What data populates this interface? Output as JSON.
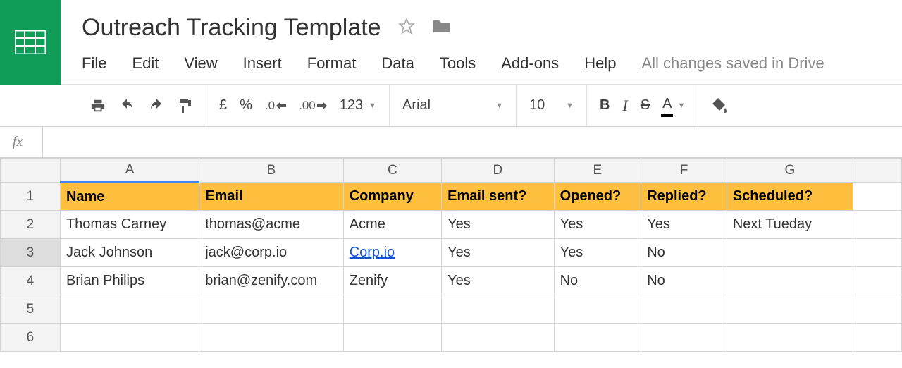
{
  "doc": {
    "title": "Outreach Tracking Template",
    "save_status": "All changes saved in Drive"
  },
  "menus": [
    "File",
    "Edit",
    "View",
    "Insert",
    "Format",
    "Data",
    "Tools",
    "Add-ons",
    "Help"
  ],
  "toolbar": {
    "currency": "£",
    "percent": "%",
    "dec_less": ".0",
    "dec_more": ".00",
    "num_format": "123",
    "font": "Arial",
    "font_size": "10",
    "bold": "B",
    "italic": "I",
    "strike": "S",
    "text_color_letter": "A"
  },
  "formula_bar": {
    "fx": "fx",
    "value": ""
  },
  "grid": {
    "columns": [
      "A",
      "B",
      "C",
      "D",
      "E",
      "F",
      "G"
    ],
    "row_labels": [
      "1",
      "2",
      "3",
      "4",
      "5",
      "6"
    ],
    "selected_row": "3",
    "header": {
      "A": "Name",
      "B": "Email",
      "C": "Company",
      "D": "Email sent?",
      "E": "Opened?",
      "F": "Replied?",
      "G": "Scheduled?"
    },
    "rows": [
      {
        "A": "Thomas Carney",
        "B": "thomas@acme",
        "C": "Acme",
        "D": "Yes",
        "E": "Yes",
        "F": "Yes",
        "G": "Next Tueday"
      },
      {
        "A": "Jack Johnson",
        "B": "jack@corp.io",
        "C": "Corp.io",
        "C_link": true,
        "D": "Yes",
        "E": "Yes",
        "F": "No",
        "G": ""
      },
      {
        "A": "Brian Philips",
        "B": "brian@zenify.com",
        "C": "Zenify",
        "D": "Yes",
        "E": "No",
        "F": "No",
        "G": ""
      }
    ]
  },
  "chart_data": {
    "type": "table",
    "columns": [
      "Name",
      "Email",
      "Company",
      "Email sent?",
      "Opened?",
      "Replied?",
      "Scheduled?"
    ],
    "rows": [
      [
        "Thomas Carney",
        "thomas@acme",
        "Acme",
        "Yes",
        "Yes",
        "Yes",
        "Next Tueday"
      ],
      [
        "Jack Johnson",
        "jack@corp.io",
        "Corp.io",
        "Yes",
        "Yes",
        "No",
        ""
      ],
      [
        "Brian Philips",
        "brian@zenify.com",
        "Zenify",
        "Yes",
        "No",
        "No",
        ""
      ]
    ]
  }
}
